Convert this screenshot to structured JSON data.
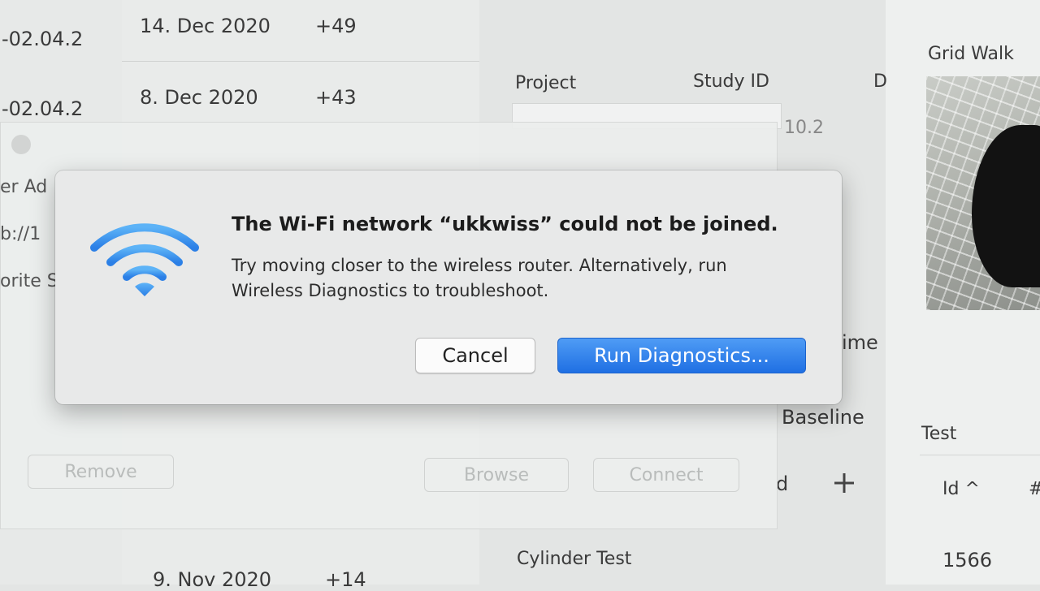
{
  "background": {
    "left_fragments": [
      "-02.04.2",
      "-02.04.2",
      "er Ad",
      "b://1",
      "orite S"
    ],
    "date_rows": [
      {
        "date": "14. Dec 2020",
        "delta": "+49"
      },
      {
        "date": "8. Dec 2020",
        "delta": "+43"
      },
      {
        "date": "9. Nov 2020",
        "delta": "+14"
      }
    ],
    "form": {
      "project_label": "Project",
      "study_id_label": "Study ID",
      "partial_col": "D",
      "partial_value": "10.2",
      "time_label": "ime",
      "baseline_label": "Baseline",
      "cylinder_test": "Cylinder Test",
      "plus_icon": "plus-icon",
      "partial_d": "d"
    },
    "sheet_buttons": {
      "remove": "Remove",
      "browse": "Browse",
      "connect": "Connect"
    },
    "right_panel": {
      "title": "Grid Walk",
      "test_label": "Test",
      "id_header": "Id ^",
      "hash_header": "#",
      "first_id": "1566"
    }
  },
  "alert": {
    "icon": "wifi-icon",
    "title": "The Wi-Fi network “ukkwiss” could not be joined.",
    "message": "Try moving closer to the wireless router. Alternatively, run Wireless Diagnostics to troubleshoot.",
    "cancel_label": "Cancel",
    "primary_label": "Run Diagnostics...",
    "accent_color": "#2f7ff0"
  }
}
